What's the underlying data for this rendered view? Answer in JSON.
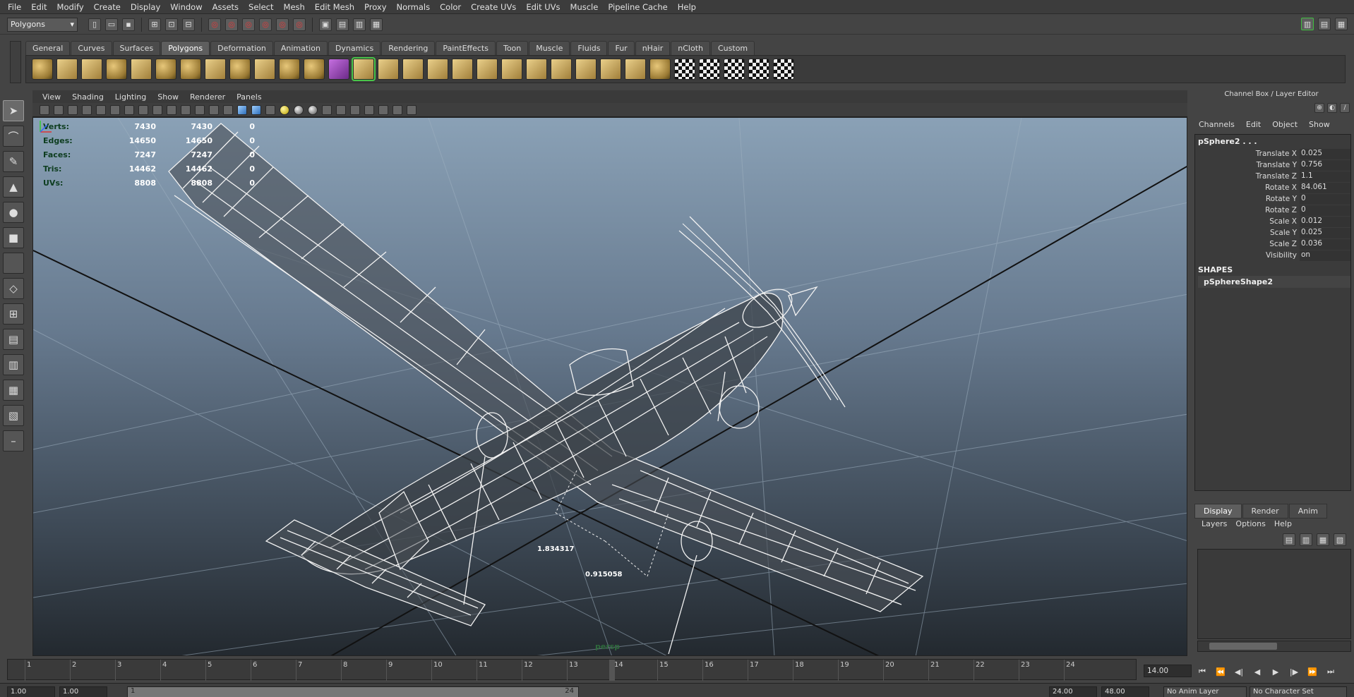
{
  "menubar": [
    "File",
    "Edit",
    "Modify",
    "Create",
    "Display",
    "Window",
    "Assets",
    "Select",
    "Mesh",
    "Edit Mesh",
    "Proxy",
    "Normals",
    "Color",
    "Create UVs",
    "Edit UVs",
    "Muscle",
    "Pipeline Cache",
    "Help"
  ],
  "status": {
    "mode": "Polygons"
  },
  "shelf": {
    "tabs": [
      "General",
      "Curves",
      "Surfaces",
      "Polygons",
      "Deformation",
      "Animation",
      "Dynamics",
      "Rendering",
      "PaintEffects",
      "Toon",
      "Muscle",
      "Fluids",
      "Fur",
      "nHair",
      "nCloth",
      "Custom"
    ],
    "active": "Polygons"
  },
  "panel": {
    "menus": [
      "View",
      "Shading",
      "Lighting",
      "Show",
      "Renderer",
      "Panels"
    ],
    "camera": "persp"
  },
  "hud": [
    {
      "label": "Verts:",
      "a": "7430",
      "b": "7430",
      "c": "0"
    },
    {
      "label": "Edges:",
      "a": "14650",
      "b": "14650",
      "c": "0"
    },
    {
      "label": "Faces:",
      "a": "7247",
      "b": "7247",
      "c": "0"
    },
    {
      "label": "Tris:",
      "a": "14462",
      "b": "14462",
      "c": "0"
    },
    {
      "label": "UVs:",
      "a": "8808",
      "b": "8808",
      "c": "0"
    }
  ],
  "dimensions": {
    "d1": "1.834317",
    "d2": "0.915058"
  },
  "channelbox": {
    "title": "Channel Box / Layer Editor",
    "menus": [
      "Channels",
      "Edit",
      "Object",
      "Show"
    ],
    "object": "pSphere2 . . .",
    "attributes": [
      {
        "name": "Translate X",
        "value": "0.025"
      },
      {
        "name": "Translate Y",
        "value": "0.756"
      },
      {
        "name": "Translate Z",
        "value": "1.1"
      },
      {
        "name": "Rotate X",
        "value": "84.061"
      },
      {
        "name": "Rotate Y",
        "value": "0"
      },
      {
        "name": "Rotate Z",
        "value": "0"
      },
      {
        "name": "Scale X",
        "value": "0.012"
      },
      {
        "name": "Scale Y",
        "value": "0.025"
      },
      {
        "name": "Scale Z",
        "value": "0.036"
      },
      {
        "name": "Visibility",
        "value": "on"
      }
    ],
    "shapes_header": "SHAPES",
    "shape": "pSphereShape2"
  },
  "layereditor": {
    "tabs": [
      "Display",
      "Render",
      "Anim"
    ],
    "menus": [
      "Layers",
      "Options",
      "Help"
    ]
  },
  "timeline": {
    "ticks": [
      "1",
      "2",
      "3",
      "4",
      "5",
      "6",
      "7",
      "8",
      "9",
      "10",
      "11",
      "12",
      "13",
      "14",
      "15",
      "16",
      "17",
      "18",
      "19",
      "20",
      "21",
      "22",
      "23",
      "24"
    ],
    "current": "14.00"
  },
  "range": {
    "start": "1.00",
    "start2": "1.00",
    "inner_start": "1",
    "inner_end": "24",
    "end": "24.00",
    "end2": "48.00",
    "anim_layer": "No Anim Layer",
    "char_set": "No Character Set"
  }
}
